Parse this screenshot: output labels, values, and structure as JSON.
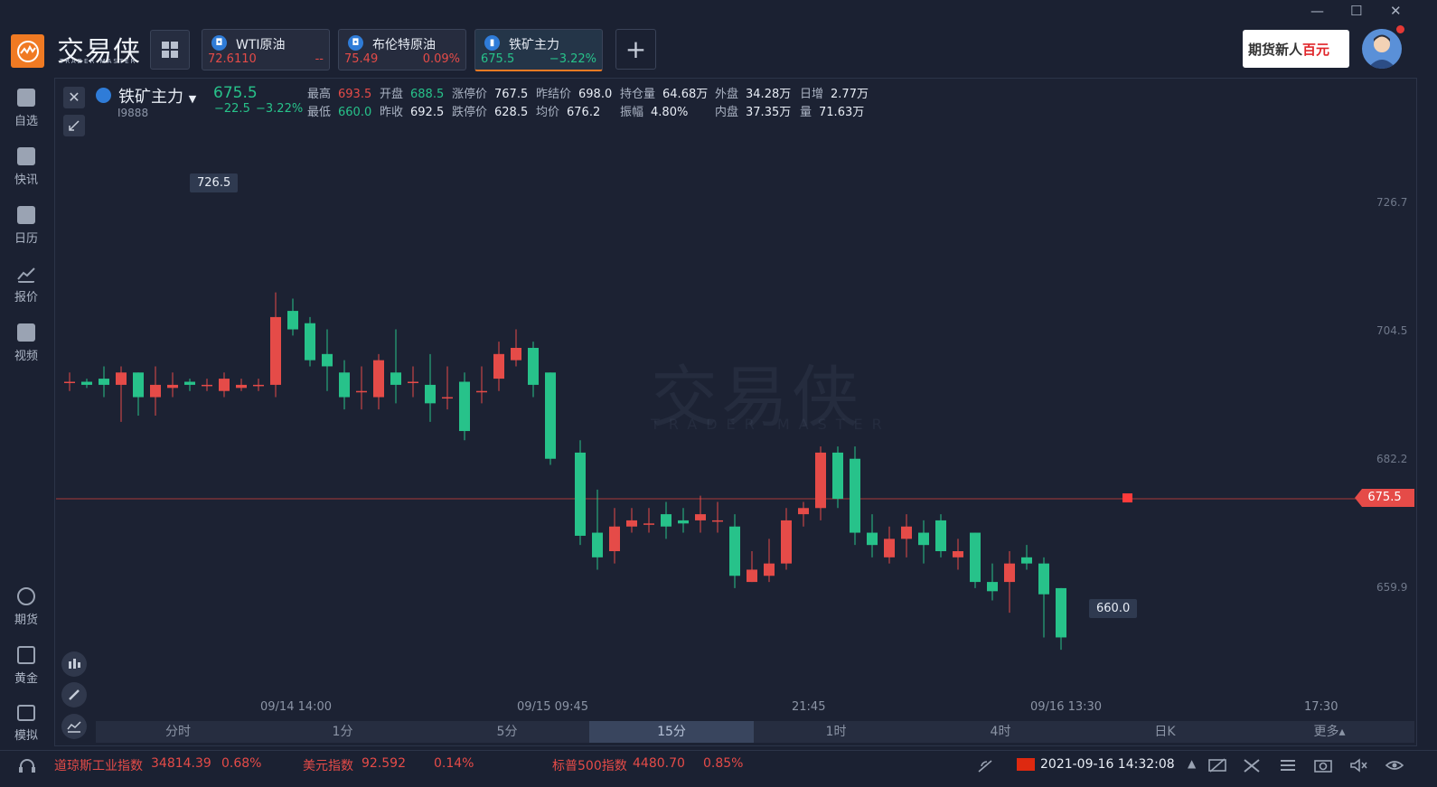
{
  "app": {
    "logo_text": "交易侠",
    "logo_sub": "TRADER MASTER",
    "window_controls": [
      "—",
      "☐",
      "✕"
    ]
  },
  "tabs": [
    {
      "name": "WTI原油",
      "price": "72.6110",
      "change": "--",
      "price_color": "#e54b48",
      "change_color": "#e54b48"
    },
    {
      "name": "布伦特原油",
      "price": "75.49",
      "change": "0.09%",
      "price_color": "#e54b48",
      "change_color": "#e54b48"
    },
    {
      "name": "铁矿主力",
      "price": "675.5",
      "change": "−3.22%",
      "price_color": "#27c28a",
      "change_color": "#27c28a"
    }
  ],
  "add_tab_label": "+",
  "promo": {
    "text": "期货新人",
    "highlight": "百元"
  },
  "sidebar": [
    {
      "label": "自选",
      "icon": "favorites-icon"
    },
    {
      "label": "快讯",
      "icon": "news-icon"
    },
    {
      "label": "日历",
      "icon": "calendar-icon"
    },
    {
      "label": "报价",
      "icon": "quotes-icon"
    },
    {
      "label": "视频",
      "icon": "video-icon"
    },
    {
      "label": "期货",
      "icon": "futures-icon"
    },
    {
      "label": "黄金",
      "icon": "gold-icon"
    },
    {
      "label": "模拟",
      "icon": "wallet-icon"
    }
  ],
  "symbol": {
    "name": "铁矿主力",
    "code": "I9888",
    "price": "675.5",
    "change": "−22.5",
    "change_pct": "−3.22%"
  },
  "quote": {
    "row1": [
      {
        "k": "最高",
        "v": "693.5",
        "color": "#e54b48"
      },
      {
        "k": "开盘",
        "v": "688.5",
        "color": "#27c28a"
      },
      {
        "k": "涨停价",
        "v": "767.5",
        "color": "#e8edf5"
      },
      {
        "k": "昨结价",
        "v": "698.0",
        "color": "#e8edf5"
      },
      {
        "k": "持仓量",
        "v": "64.68万",
        "color": "#e8edf5"
      },
      {
        "k": "外盘",
        "v": "34.28万",
        "color": "#e8edf5"
      },
      {
        "k": "日增",
        "v": "2.77万",
        "color": "#e8edf5"
      }
    ],
    "row2": [
      {
        "k": "最低",
        "v": "660.0",
        "color": "#27c28a"
      },
      {
        "k": "昨收",
        "v": "692.5",
        "color": "#e8edf5"
      },
      {
        "k": "跌停价",
        "v": "628.5",
        "color": "#e8edf5"
      },
      {
        "k": "均价",
        "v": "676.2",
        "color": "#e8edf5"
      },
      {
        "k": "振幅",
        "v": "4.80%",
        "color": "#e8edf5"
      },
      {
        "k": "内盘",
        "v": "37.35万",
        "color": "#e8edf5"
      },
      {
        "k": "量",
        "v": "71.63万",
        "color": "#e8edf5"
      }
    ]
  },
  "chart_data": {
    "type": "candlestick",
    "y_ticks": [
      "726.7",
      "704.5",
      "682.2",
      "659.9"
    ],
    "ylim": [
      645,
      733
    ],
    "x_ticks": [
      "09/14 14:00",
      "09/15 09:45",
      "21:45",
      "09/16 13:30",
      "17:30"
    ],
    "max_label": "726.5",
    "min_label": "660.0",
    "last_price": "675.5",
    "candles": [
      [
        694.5,
        694.5,
        693,
        696
      ],
      [
        694.5,
        694,
        693.5,
        695
      ],
      [
        695,
        694,
        692,
        697
      ],
      [
        694,
        696,
        688,
        697
      ],
      [
        696,
        692,
        689,
        696
      ],
      [
        692,
        694,
        689,
        697
      ],
      [
        693.5,
        694,
        692,
        696
      ],
      [
        694.5,
        694,
        693,
        695
      ],
      [
        694,
        694,
        693,
        695
      ],
      [
        693,
        695,
        692,
        696
      ],
      [
        693.5,
        694,
        693,
        695
      ],
      [
        694,
        694,
        693,
        695
      ],
      [
        694,
        705,
        692,
        709
      ],
      [
        706,
        703,
        702,
        708
      ],
      [
        704,
        698,
        697,
        705
      ],
      [
        699,
        697,
        693,
        703
      ],
      [
        696,
        692,
        690,
        698
      ],
      [
        693,
        693,
        690,
        697
      ],
      [
        692,
        698,
        690,
        699
      ],
      [
        696,
        694,
        691,
        703
      ],
      [
        694.5,
        694.5,
        692,
        697
      ],
      [
        694,
        691,
        688,
        699
      ],
      [
        692,
        692,
        690,
        697
      ],
      [
        694.5,
        686.5,
        685,
        696
      ],
      [
        693,
        693,
        691,
        697
      ],
      [
        695,
        699,
        693,
        701
      ],
      [
        698,
        700,
        697,
        703
      ],
      [
        700,
        694,
        692,
        701
      ],
      [
        696,
        682,
        681,
        696
      ],
      [
        683,
        669.5,
        668,
        685
      ],
      [
        670,
        666,
        664,
        677
      ],
      [
        667,
        671,
        665,
        674
      ],
      [
        671,
        672,
        670,
        674
      ],
      [
        671.5,
        671.5,
        670,
        674
      ],
      [
        673,
        671,
        669,
        675
      ],
      [
        672,
        671.5,
        670,
        674
      ],
      [
        672,
        673,
        670,
        676
      ],
      [
        672,
        672,
        670,
        675
      ],
      [
        671,
        663,
        661,
        673
      ],
      [
        662,
        664,
        662,
        667
      ],
      [
        663,
        665,
        662,
        669
      ],
      [
        665,
        672,
        664,
        674
      ],
      [
        673,
        674,
        671,
        675
      ],
      [
        674,
        683,
        672,
        684
      ],
      [
        683,
        675.5,
        674,
        684
      ],
      [
        682,
        670,
        668,
        684
      ],
      [
        670,
        668,
        666,
        673
      ],
      [
        666,
        669,
        665,
        671
      ],
      [
        669,
        671,
        666,
        673
      ],
      [
        670,
        668,
        665,
        672
      ],
      [
        672,
        667,
        666,
        673
      ],
      [
        666,
        667,
        664,
        669
      ],
      [
        670,
        662,
        661,
        670
      ],
      [
        662,
        660.5,
        659,
        665
      ],
      [
        662,
        665,
        657,
        667
      ],
      [
        666,
        665,
        664,
        668
      ],
      [
        665,
        660,
        653,
        666
      ],
      [
        661,
        653,
        651,
        661
      ]
    ]
  },
  "periods": [
    "分时",
    "1分",
    "5分",
    "15分",
    "1时",
    "4时",
    "日K",
    "更多▴"
  ],
  "active_period": "15分",
  "ticker": [
    {
      "name": "道琼斯工业指数",
      "value": "34814.39",
      "pct": "0.68%"
    },
    {
      "name": "美元指数",
      "value": "92.592",
      "pct": "0.14%"
    },
    {
      "name": "标普500指数",
      "value": "4480.70",
      "pct": "0.85%"
    }
  ],
  "clock": "2021-09-16 14:32:08",
  "colors": {
    "up": "#e54b48",
    "down": "#27c28a",
    "bg": "#1c2233",
    "accent": "#f07a23"
  }
}
